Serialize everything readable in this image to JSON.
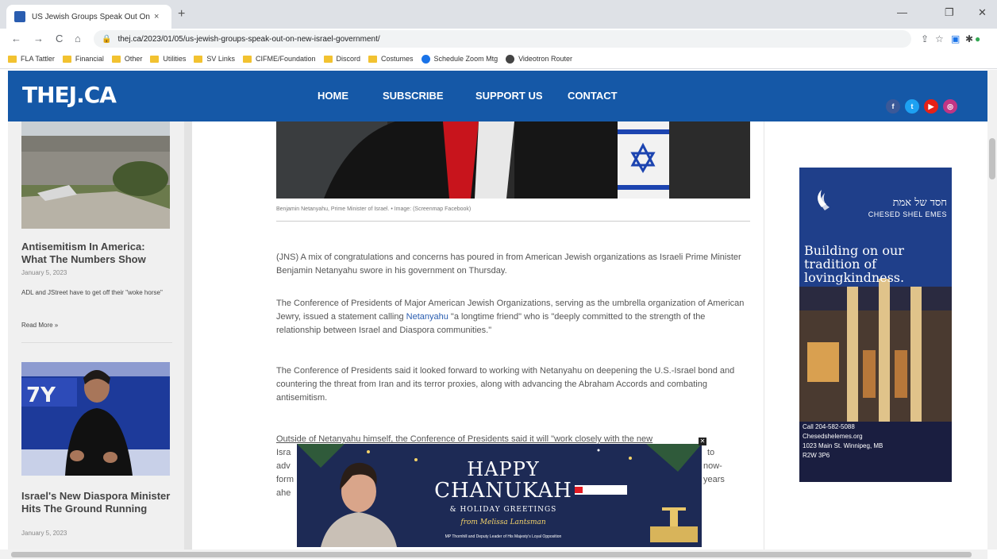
{
  "browser": {
    "tab_title": "US Jewish Groups Speak Out On",
    "tab_close": "×",
    "new_tab": "+",
    "url": "thej.ca/2023/01/05/us-jewish-groups-speak-out-on-new-israel-government/",
    "nav": {
      "back": "←",
      "forward": "→",
      "reload": "C",
      "home": "⌂"
    },
    "window": {
      "minimize": "—",
      "restore": "❐",
      "close": "✕"
    },
    "bookmarks": [
      "FLA Tattler",
      "Financial",
      "Other",
      "Utilities",
      "SV Links",
      "CIFME/Foundation",
      "Discord",
      "Costumes",
      "Schedule Zoom Mtg",
      "Videotron Router"
    ]
  },
  "site": {
    "logo": "THEJ.CA",
    "menu": [
      "HOME",
      "SUBSCRIBE",
      "SUPPORT US",
      "CONTACT"
    ],
    "social": [
      "f",
      "t",
      "▶",
      "◎"
    ],
    "social_colors": [
      "#3b5998",
      "#1da1f2",
      "#e62117",
      "#c13584"
    ]
  },
  "sidebar": {
    "post1": {
      "title": "Antisemitism In America: What The Numbers Show",
      "date": "January 5, 2023",
      "excerpt": "ADL and JStreet have to get off their \"woke horse\"",
      "read_more": "Read More »"
    },
    "post2": {
      "title": "Israel's New Diaspora Minister Hits The Ground Running",
      "date": "January 5, 2023"
    }
  },
  "article": {
    "caption": "Benjamin Netanyahu, Prime Minister of Israel. • Image: (Screenmap Facebook)",
    "p1": "(JNS) A mix of congratulations and concerns has poured in from American Jewish organizations as Israeli Prime Minister Benjamin Netanyahu swore in his government on Thursday.",
    "p2a": "The Conference of Presidents of Major American Jewish Organizations, serving as the umbrella organization of American Jewry, issued a statement calling ",
    "p2b": "Netanyahu",
    "p2c": " \"a longtime friend\" who is \"deeply committed to the strength of the relationship between Israel and Diaspora communities.\"",
    "p3": "The Conference of Presidents said it looked forward to working with Netanyahu on deepening the U.S.-Israel bond and countering the threat from Iran and its terror proxies, along with advancing the Abraham Accords and combating antisemitism.",
    "p4_line1": "Outside of Netanyahu himself, the Conference of Presidents said it will \"work closely with the new",
    "p4_left": [
      "Isra",
      "adv",
      "form",
      "ahe"
    ],
    "p4_right": [
      "to",
      "now-",
      "years"
    ]
  },
  "ad_right": {
    "hebrew": "חסד של אמת",
    "brand": "CHESED SHEL EMES",
    "tagline": "Building on our tradition of lovingkindness.",
    "phone": "Call 204-582-5088",
    "site": "Chesedshelemes.org",
    "address": "1023 Main St. Winnipeg, MB",
    "postal": "R2W 3P6"
  },
  "popup": {
    "happy": "HAPPY",
    "chanukah": "CHANUKAH",
    "holiday": "& HOLIDAY GREETINGS",
    "from": "from Melissa Lantsman",
    "footer": "MP Thornhill and Deputy Leader of His Majesty's Loyal Opposition",
    "close": "✕"
  }
}
